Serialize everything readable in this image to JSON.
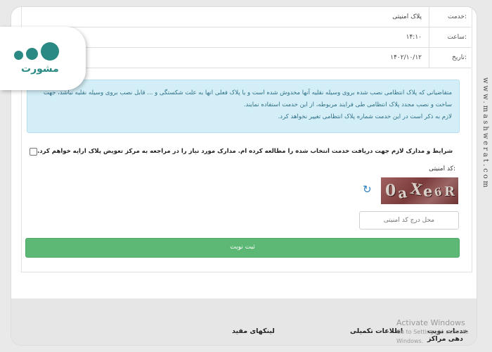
{
  "table": {
    "rows": [
      {
        "label": "خدمت:",
        "value": "پلاک امنیتی"
      },
      {
        "label": "ساعت:",
        "value": "۱۴:۱۰"
      },
      {
        "label": "تاریخ:",
        "value": "۱۴۰۲/۱۰/۱۲"
      }
    ]
  },
  "notice": {
    "paragraph1": "متقاضیانی که پلاک انتظامی نصب شده بروی وسیله نقلیه آنها مخدوش شده است و یا پلاک فعلی انها به علت شکستگی و ... قابل نصب بروی وسیله نقلیه نباشد، جهت ساخت و نصب مجدد پلاک انتظامی طی فرایند مربوطه، از این خدمت استفاده نمایند.",
    "paragraph2": "لازم به ذکر است در این خدمت شماره پلاک انتظامی تغییر نخواهد کرد."
  },
  "terms": {
    "text": "شرایط و مدارک لازم جهت دریافت خدمت انتخاب شده را مطالعه کرده ام. مدارک مورد نیاز را در مراجعه به مرکز تعویض پلاک ارایه خواهم کرد.",
    "checked": false
  },
  "captcha": {
    "label": "کد امنیتی:",
    "code_chars": [
      "0",
      "a",
      "X",
      "e",
      "6",
      "R"
    ],
    "input_placeholder": "محل درج کد امنیتی"
  },
  "submit_label": "ثبت نوبت",
  "footer": {
    "links": [
      "خدمات نوبت دهی مراکز",
      "اطلاعات تکمیلی",
      "لینکهای مفید"
    ]
  },
  "windows_notice": {
    "title": "Activate Windows",
    "subtitle": "Go to Settings to activate Windows."
  },
  "logo": {
    "text": "مشورت",
    "color": "#2a8a83"
  },
  "watermark": "www.mashwerat.com",
  "colors": {
    "notice_bg": "#d3eef7",
    "notice_text": "#2f6f86",
    "submit_bg": "#5cb874",
    "refresh_icon": "#2a7fc0"
  }
}
